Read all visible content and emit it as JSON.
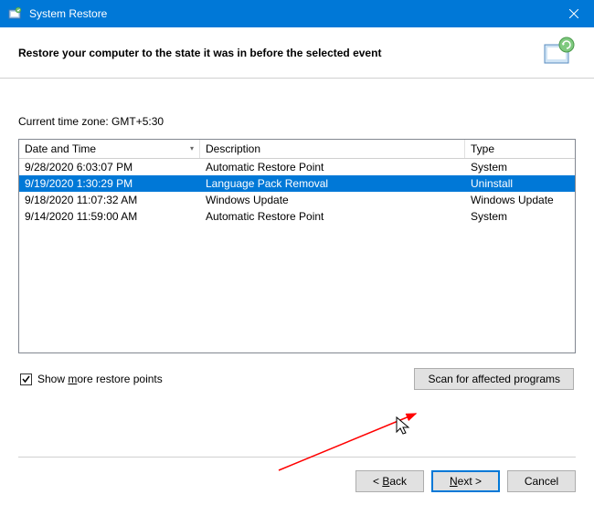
{
  "titlebar": {
    "title": "System Restore"
  },
  "header": {
    "title": "Restore your computer to the state it was in before the selected event"
  },
  "content": {
    "timezone_label": "Current time zone: GMT+5:30",
    "columns": {
      "date": "Date and Time",
      "description": "Description",
      "type": "Type"
    },
    "rows": [
      {
        "date": "9/28/2020 6:03:07 PM",
        "description": "Automatic Restore Point",
        "type": "System",
        "selected": false
      },
      {
        "date": "9/19/2020 1:30:29 PM",
        "description": "Language Pack Removal",
        "type": "Uninstall",
        "selected": true
      },
      {
        "date": "9/18/2020 11:07:32 AM",
        "description": "Windows Update",
        "type": "Windows Update",
        "selected": false
      },
      {
        "date": "9/14/2020 11:59:00 AM",
        "description": "Automatic Restore Point",
        "type": "System",
        "selected": false
      }
    ]
  },
  "options": {
    "show_more_label_pre": "Show ",
    "show_more_underline": "m",
    "show_more_label_post": "ore restore points",
    "show_more_checked": true,
    "scan_label": "Scan for affected programs"
  },
  "footer": {
    "back_pre": "< ",
    "back_underline": "B",
    "back_post": "ack",
    "next_underline": "N",
    "next_post": "ext >",
    "cancel": "Cancel"
  }
}
